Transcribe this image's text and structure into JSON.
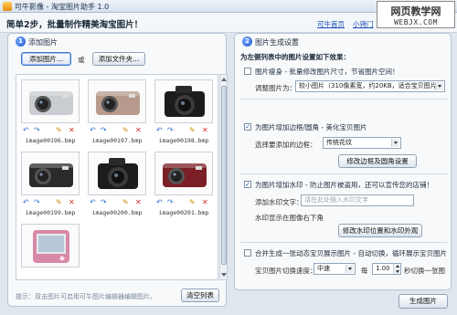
{
  "window": {
    "title": "可牛影像 - 淘宝图片助手 1.0"
  },
  "header": {
    "heading": "简单2步，批量制作精美淘宝图片！",
    "links": {
      "home": "可牛首页",
      "tips": "小窍门"
    }
  },
  "watermark": {
    "text": "网页教学网",
    "url": "WEBJX.COM"
  },
  "left_panel": {
    "step": "1",
    "title": "添加图片",
    "add_images_button": "添加图片...",
    "or_label": "或",
    "add_folder_button": "添加文件夹...",
    "images": [
      {
        "filename": "image00196.bmp",
        "kind": "compact-silver"
      },
      {
        "filename": "image00197.bmp",
        "kind": "compact-pink"
      },
      {
        "filename": "image00198.bmp",
        "kind": "dslr-black"
      },
      {
        "filename": "image00199.bmp",
        "kind": "compact-black"
      },
      {
        "filename": "image00200.bmp",
        "kind": "dslr-black"
      },
      {
        "filename": "image00201.bmp",
        "kind": "compact-red"
      },
      {
        "filename": "",
        "kind": "compact-pink-front"
      }
    ],
    "hint": "提示：双击图片可启用可牛图片编辑器编辑图片。",
    "clear_button": "清空列表"
  },
  "right_panel": {
    "step": "2",
    "title": "图片生成设置",
    "subtitle": "为左侧列表中的图片设置如下效果：",
    "options": {
      "resize": {
        "checked": false,
        "label": "图片瘦身 - 批量修改图片尺寸，节省图片空间！",
        "size_label": "调整图片为：",
        "size_value": "较小图片（310像素宽，约20KB，适合宝贝图片）"
      },
      "border": {
        "checked": true,
        "label": "为图片增加边框/圆角 - 美化宝贝图片",
        "select_label": "选择要添加的边框：",
        "select_value": "传统花纹",
        "button": "修改边框及圆角设置"
      },
      "watermark": {
        "checked": true,
        "label": "为图片增加水印 - 防止图片被盗用，还可以宣传您的店铺！",
        "text_label": "添加水印文字：",
        "text_placeholder": "请在此处输入水印文字",
        "position_label": "水印显示在图像右下角",
        "button": "修改水印位置和水印外观"
      },
      "merge": {
        "checked": false,
        "label": "合并生成一张动态宝贝展示图片 - 自动切换，循环展示宝贝图片",
        "speed_label": "宝贝图片切换速度：",
        "speed_value": "中速",
        "each_label": "每",
        "interval_value": "1.00",
        "interval_unit": "秒切换一张图"
      }
    }
  },
  "footer": {
    "generate_button": "生成图片"
  },
  "colors": {
    "link": "#1a4fb5",
    "accent": "#1f56c9",
    "frame": "#dfe6ee"
  }
}
